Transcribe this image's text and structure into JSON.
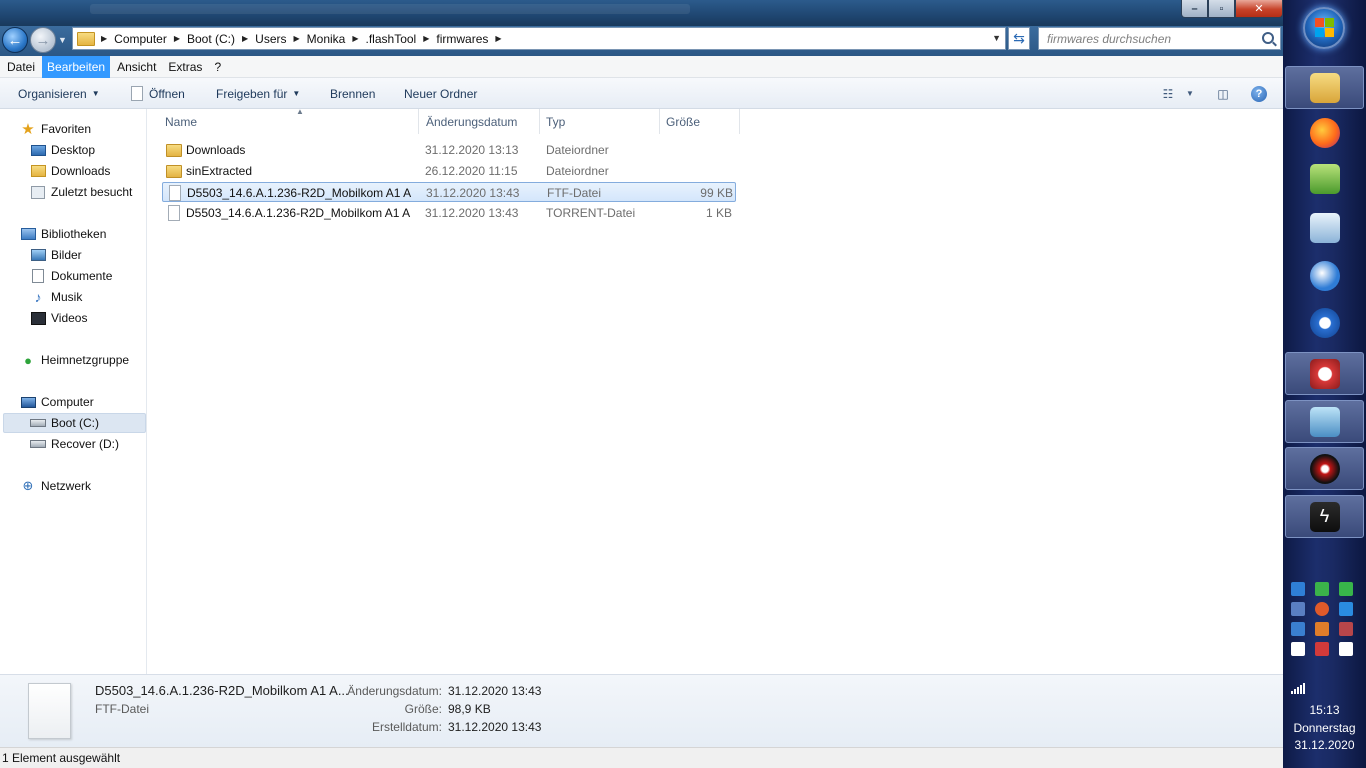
{
  "address": {
    "crumbs": [
      "Computer",
      "Boot (C:)",
      "Users",
      "Monika",
      ".flashTool",
      "firmwares"
    ],
    "search_placeholder": "firmwares durchsuchen"
  },
  "menu": [
    "Datei",
    "Bearbeiten",
    "Ansicht",
    "Extras",
    "?"
  ],
  "toolbar": {
    "organize": "Organisieren",
    "open": "Öffnen",
    "share": "Freigeben für",
    "burn": "Brennen",
    "new_folder": "Neuer Ordner"
  },
  "nav": {
    "favorites": "Favoriten",
    "desktop": "Desktop",
    "downloads": "Downloads",
    "recent": "Zuletzt besucht",
    "libraries": "Bibliotheken",
    "pictures": "Bilder",
    "documents": "Dokumente",
    "music": "Musik",
    "videos": "Videos",
    "homegroup": "Heimnetzgruppe",
    "computer": "Computer",
    "boot": "Boot (C:)",
    "recover": "Recover (D:)",
    "network": "Netzwerk"
  },
  "columns": {
    "name": "Name",
    "date": "Änderungsdatum",
    "type": "Typ",
    "size": "Größe"
  },
  "files": [
    {
      "name": "Downloads",
      "date": "31.12.2020 13:13",
      "type": "Dateiordner",
      "size": "",
      "icon": "folder-icon"
    },
    {
      "name": "sinExtracted",
      "date": "26.12.2020 11:15",
      "type": "Dateiordner",
      "size": "",
      "icon": "folder-icon"
    },
    {
      "name": "D5503_14.6.A.1.236-R2D_Mobilkom A1 A...",
      "date": "31.12.2020 13:43",
      "type": "FTF-Datei",
      "size": "99 KB",
      "icon": "file-icon"
    },
    {
      "name": "D5503_14.6.A.1.236-R2D_Mobilkom A1 A...",
      "date": "31.12.2020 13:43",
      "type": "TORRENT-Datei",
      "size": "1 KB",
      "icon": "file-icon"
    }
  ],
  "details": {
    "name": "D5503_14.6.A.1.236-R2D_Mobilkom A1 A...",
    "type": "FTF-Datei",
    "modified_label": "Änderungsdatum:",
    "modified": "31.12.2020 13:43",
    "size_label": "Größe:",
    "size": "98,9 KB",
    "created_label": "Erstelldatum:",
    "created": "31.12.2020 13:43"
  },
  "status": "1 Element ausgewählt",
  "clock": {
    "time": "15:13",
    "day": "Donnerstag",
    "date": "31.12.2020"
  },
  "colors": {
    "accent": "#3399ff",
    "selection": "#d4e6fb"
  }
}
